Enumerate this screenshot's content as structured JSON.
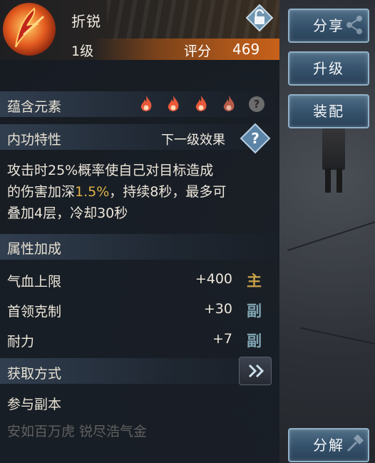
{
  "item": {
    "name": "折锐",
    "level": "1级",
    "rating_label": "评分",
    "rating_value": "469"
  },
  "elements": {
    "label": "蕴含元素",
    "flame_count": 4,
    "flame_colors": [
      "#e8583a",
      "#e8583a",
      "#e8583a",
      "#b75a48"
    ]
  },
  "internal": {
    "label": "内功特性",
    "next_effect": "下一级效果",
    "desc_part1": "攻击时25%概率使自己对目标造成",
    "desc_part2a": "的伤害加深",
    "desc_highlight": "1.5%",
    "desc_part2b": "，持续8秒，最多可",
    "desc_part3": "叠加4层，冷却30秒"
  },
  "attributes": {
    "label": "属性加成",
    "rows": [
      {
        "name": "气血上限",
        "value": "+400",
        "tag": "主",
        "tag_type": "main"
      },
      {
        "name": "首领克制",
        "value": "+30",
        "tag": "副",
        "tag_type": "sub"
      },
      {
        "name": "耐力",
        "value": "+7",
        "tag": "副",
        "tag_type": "sub"
      }
    ]
  },
  "acquire": {
    "label": "获取方式",
    "method": "参与副本",
    "faded_text": "安如百万虎 锐尽浩气金"
  },
  "buttons": {
    "share": "分享",
    "upgrade": "升级",
    "equip": "装配",
    "disassemble": "分解"
  },
  "colors": {
    "accent_orange": "#c8611a",
    "highlight_gold": "#e0b24a",
    "button_blue": "#34506a"
  }
}
